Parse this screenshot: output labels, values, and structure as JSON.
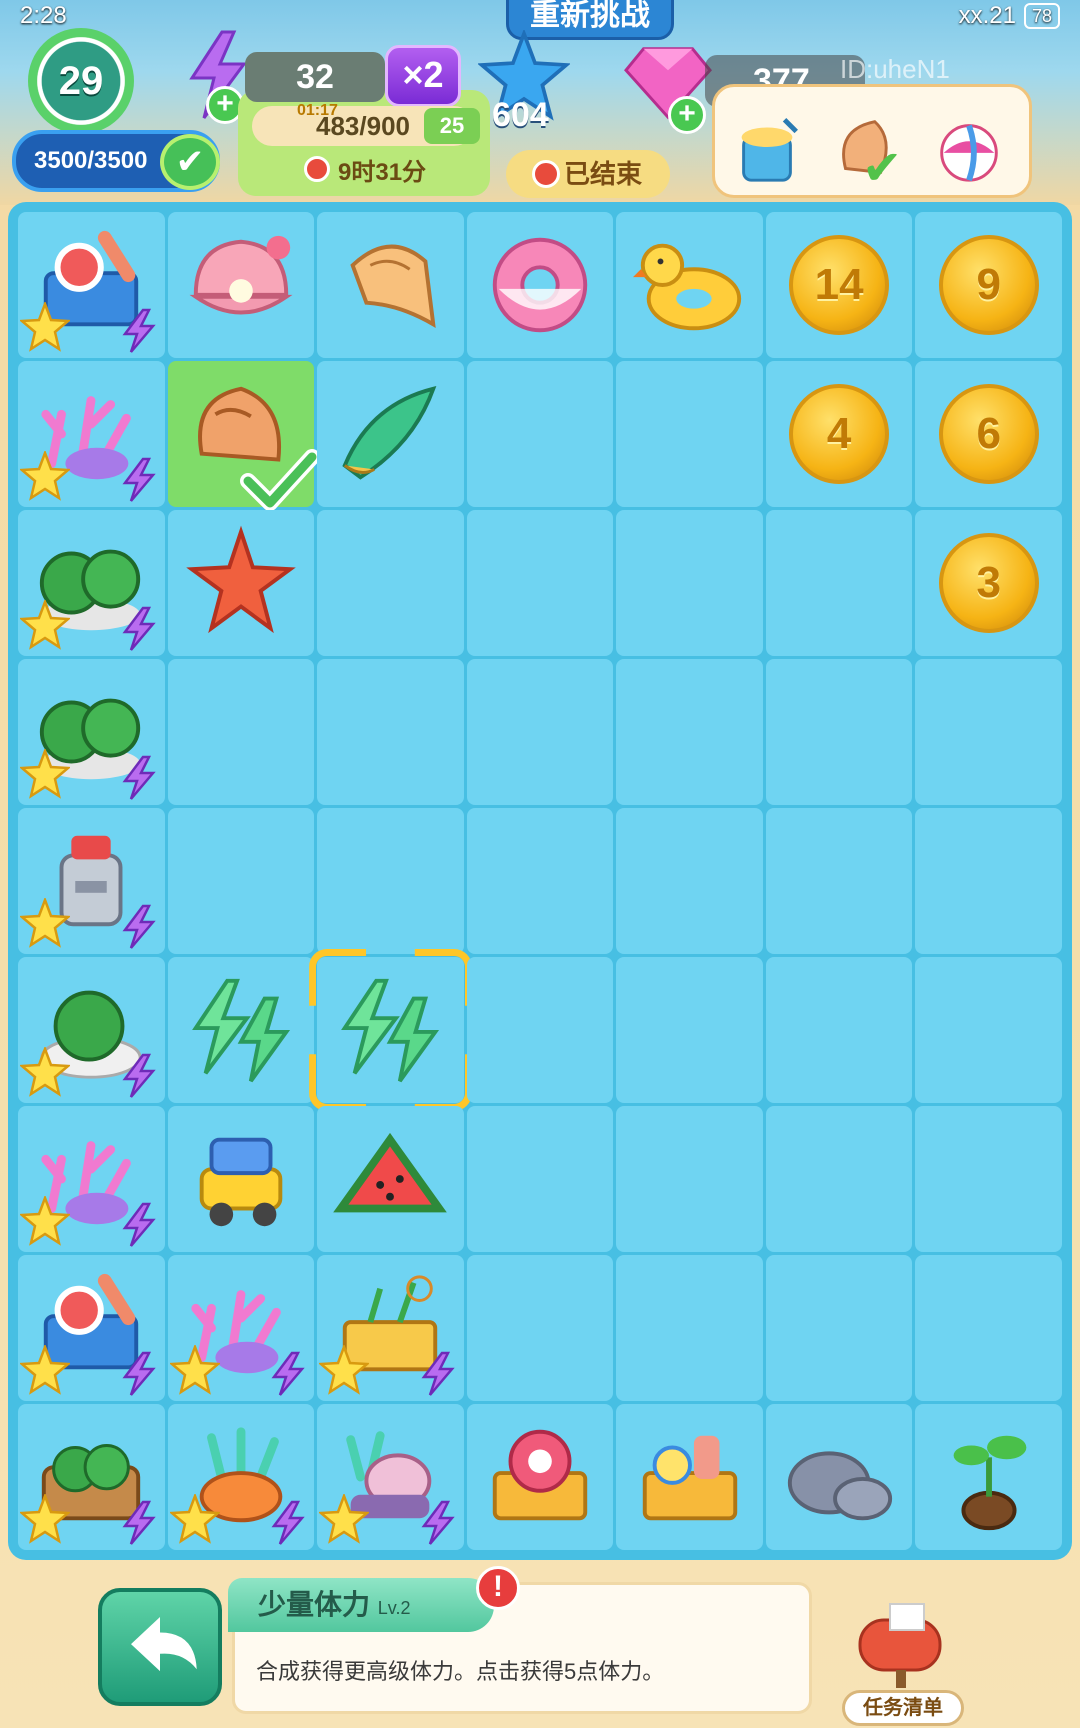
{
  "status_bar": {
    "time": "2:28",
    "signal": "xx.21",
    "battery": "78"
  },
  "header": {
    "level": "29",
    "energy": "3500/3500",
    "gold": "32",
    "multiplier": "×2",
    "challenge_label": "重新挑战",
    "score_small": "01:17",
    "score": "483/900",
    "score_badge": "25",
    "timer": "9时31分",
    "stars": "604",
    "ended_label": "已结束",
    "gems": "377",
    "player_id": "ID:uheN1"
  },
  "board": {
    "rows": [
      [
        {
          "item": "surf-kit-generator",
          "kind": "generator"
        },
        {
          "item": "pearl-clam",
          "kind": "item"
        },
        {
          "item": "conch-shell",
          "kind": "item"
        },
        {
          "item": "donut-float",
          "kind": "item"
        },
        {
          "item": "duck-float",
          "kind": "item"
        },
        {
          "item": "coin",
          "kind": "coin",
          "value": "14"
        },
        {
          "item": "coin",
          "kind": "coin",
          "value": "9"
        }
      ],
      [
        {
          "item": "coral-generator",
          "kind": "generator"
        },
        {
          "item": "spiral-shell",
          "kind": "item",
          "selected": true,
          "checked": true
        },
        {
          "item": "green-shell",
          "kind": "item"
        },
        {
          "item": "",
          "kind": "empty"
        },
        {
          "item": "",
          "kind": "empty"
        },
        {
          "item": "coin",
          "kind": "coin",
          "value": "4"
        },
        {
          "item": "coin",
          "kind": "coin",
          "value": "6"
        }
      ],
      [
        {
          "item": "watermelon-generator",
          "kind": "generator"
        },
        {
          "item": "starfish",
          "kind": "item"
        },
        {
          "item": "",
          "kind": "empty"
        },
        {
          "item": "",
          "kind": "empty"
        },
        {
          "item": "",
          "kind": "empty"
        },
        {
          "item": "",
          "kind": "empty"
        },
        {
          "item": "coin",
          "kind": "coin",
          "value": "3"
        }
      ],
      [
        {
          "item": "watermelon-generator",
          "kind": "generator"
        },
        {
          "item": "",
          "kind": "empty"
        },
        {
          "item": "",
          "kind": "empty"
        },
        {
          "item": "",
          "kind": "empty"
        },
        {
          "item": "",
          "kind": "empty"
        },
        {
          "item": "",
          "kind": "empty"
        },
        {
          "item": "",
          "kind": "empty"
        }
      ],
      [
        {
          "item": "juicer-generator",
          "kind": "generator"
        },
        {
          "item": "",
          "kind": "empty"
        },
        {
          "item": "",
          "kind": "empty"
        },
        {
          "item": "",
          "kind": "empty"
        },
        {
          "item": "",
          "kind": "empty"
        },
        {
          "item": "",
          "kind": "empty"
        },
        {
          "item": "",
          "kind": "empty"
        }
      ],
      [
        {
          "item": "watermelon-plate-generator",
          "kind": "generator"
        },
        {
          "item": "energy-bolts",
          "kind": "item"
        },
        {
          "item": "energy-bolts",
          "kind": "item",
          "focused": true
        },
        {
          "item": "",
          "kind": "empty"
        },
        {
          "item": "",
          "kind": "empty"
        },
        {
          "item": "",
          "kind": "empty"
        },
        {
          "item": "",
          "kind": "empty"
        }
      ],
      [
        {
          "item": "coral-generator",
          "kind": "generator"
        },
        {
          "item": "toy-dump-truck",
          "kind": "item"
        },
        {
          "item": "watermelon-slices",
          "kind": "item"
        },
        {
          "item": "",
          "kind": "empty"
        },
        {
          "item": "",
          "kind": "empty"
        },
        {
          "item": "",
          "kind": "empty"
        },
        {
          "item": "",
          "kind": "empty"
        }
      ],
      [
        {
          "item": "surf-kit-generator",
          "kind": "generator"
        },
        {
          "item": "coral-generator",
          "kind": "generator"
        },
        {
          "item": "picnic-basket-generator",
          "kind": "generator"
        },
        {
          "item": "",
          "kind": "empty"
        },
        {
          "item": "",
          "kind": "empty"
        },
        {
          "item": "",
          "kind": "empty"
        },
        {
          "item": "",
          "kind": "empty"
        }
      ],
      [
        {
          "item": "watermelon-basket-generator",
          "kind": "generator"
        },
        {
          "item": "orange-coral-generator",
          "kind": "generator"
        },
        {
          "item": "shell-coral-generator",
          "kind": "generator"
        },
        {
          "item": "float-basket",
          "kind": "item"
        },
        {
          "item": "beach-basket",
          "kind": "item"
        },
        {
          "item": "rocks",
          "kind": "item"
        },
        {
          "item": "sprout",
          "kind": "item"
        }
      ]
    ]
  },
  "selected_info": {
    "title": "少量体力",
    "level": "Lv.2",
    "description": "合成获得更高级体力。点击获得5点体力。",
    "alert": "!"
  },
  "bottom": {
    "task_list_label": "任务清单"
  },
  "colors": {
    "board": "#47bfe3",
    "cell": "#6fd4f2",
    "selected_cell": "#7fdc69",
    "focus_frame": "#ffc628"
  }
}
